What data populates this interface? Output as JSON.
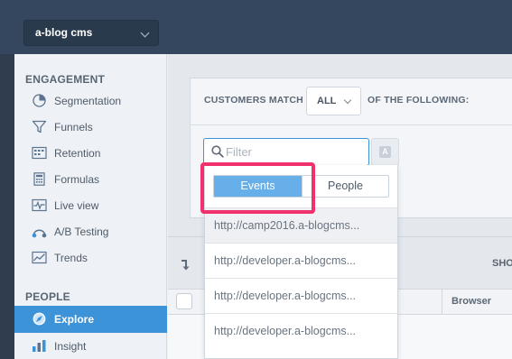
{
  "project": {
    "name": "a-blog cms"
  },
  "sidebar": {
    "sections": [
      {
        "title": "ENGAGEMENT",
        "items": [
          {
            "label": "Segmentation",
            "icon": "segmentation-icon"
          },
          {
            "label": "Funnels",
            "icon": "funnels-icon"
          },
          {
            "label": "Retention",
            "icon": "retention-icon"
          },
          {
            "label": "Formulas",
            "icon": "formulas-icon"
          },
          {
            "label": "Live view",
            "icon": "live-view-icon"
          },
          {
            "label": "A/B Testing",
            "icon": "ab-testing-icon"
          },
          {
            "label": "Trends",
            "icon": "trends-icon"
          }
        ]
      },
      {
        "title": "PEOPLE",
        "items": [
          {
            "label": "Explore",
            "icon": "explore-icon",
            "active": true
          },
          {
            "label": "Insight",
            "icon": "insight-icon"
          }
        ]
      }
    ]
  },
  "filter": {
    "customers_match_label": "CUSTOMERS MATCH",
    "match_value": "ALL",
    "of_following_label": "OF THE FOLLOWING:",
    "search_placeholder": "Filter",
    "search_value": "",
    "az_label": "A"
  },
  "dropdown": {
    "toggle": {
      "events_label": "Events",
      "people_label": "People",
      "selected": "Events"
    },
    "items": [
      "http://camp2016.a-blogcms...",
      "http://developer.a-blogcms...",
      "http://developer.a-blogcms...",
      "http://developer.a-blogcms..."
    ]
  },
  "table": {
    "show_label": "SHO",
    "columns": {
      "browser": "Browser"
    }
  },
  "colors": {
    "accent": "#3d93d8",
    "toggle_active": "#67afe8",
    "highlight": "#f0316c",
    "topbar": "#34475e"
  }
}
